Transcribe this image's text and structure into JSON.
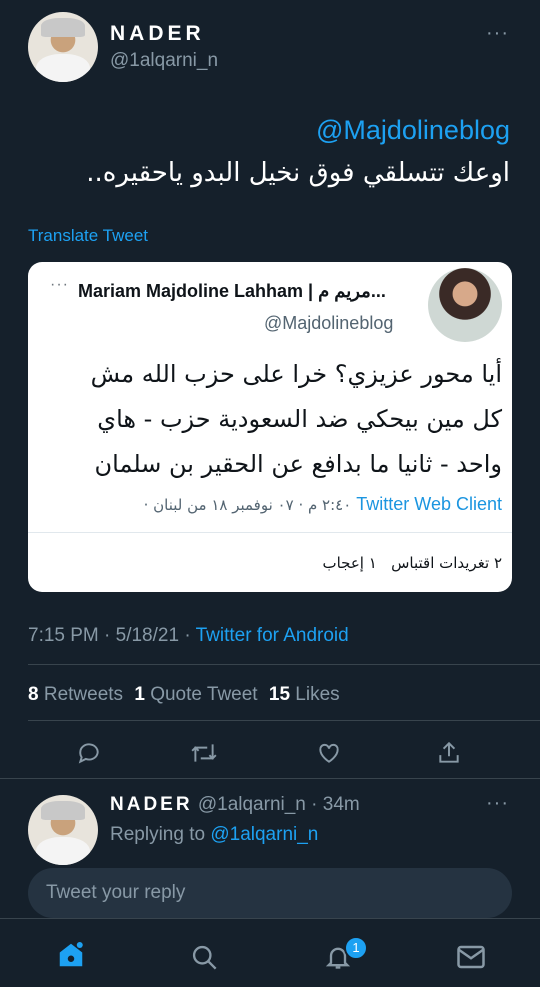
{
  "author": {
    "name": "NADER",
    "handle": "@1alqarni_n",
    "more": "···"
  },
  "tweet": {
    "mention": "@Majdolineblog",
    "text": "اوعك تتسلقي فوق نخيل البدو ياحقيره..",
    "translate": "Translate Tweet"
  },
  "quoted": {
    "name": "Mariam Majdoline Lahham | مريم م...",
    "handle": "@Majdolineblog",
    "lines": [
      "أيا محور عزيزي؟ خرا على حزب الله مش",
      "كل مين بيحكي ضد السعودية حزب - هاي",
      "واحد - ثانيا ما بدافع عن الحقير بن سلمان"
    ],
    "meta_date": "٢:٤٠ م · ٠٧ نوفمبر ١٨ من لبنان ·",
    "meta_client": "Twitter Web Client",
    "stats": "٢ تغريدات اقتباس   ١ إعجاب"
  },
  "meta": {
    "time": "7:15 PM · 5/18/21 · ",
    "client": "Twitter for Android"
  },
  "stats": {
    "retweets_count": "8",
    "retweets_label": "Retweets",
    "quotes_count": "1",
    "quotes_label": "Quote Tweet",
    "likes_count": "15",
    "likes_label": "Likes"
  },
  "reply": {
    "name": "NADER",
    "handle": "@1alqarni_n",
    "time": "· 34m",
    "replying_prefix": "Replying to ",
    "replying_handle": "@1alqarni_n",
    "more": "···"
  },
  "composer": {
    "placeholder": "Tweet your reply"
  },
  "tabbar": {
    "notifications_badge": "1"
  },
  "colors": {
    "background": "#15202b",
    "accent": "#1da1f2",
    "muted": "#8899a6"
  }
}
